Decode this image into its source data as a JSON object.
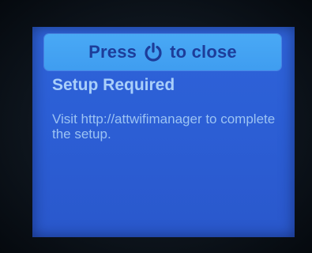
{
  "banner": {
    "press_label": "Press",
    "close_label": "to close",
    "icon": "power-icon"
  },
  "setup": {
    "title": "Setup Required",
    "message": "Visit http://attwifimanager to complete the setup."
  },
  "colors": {
    "screen_background": "#2c5fd6",
    "banner_background": "#45a3f3",
    "banner_text": "#1d3d9a",
    "title_text": "#a9cffa",
    "message_text": "#9cc3f3"
  }
}
